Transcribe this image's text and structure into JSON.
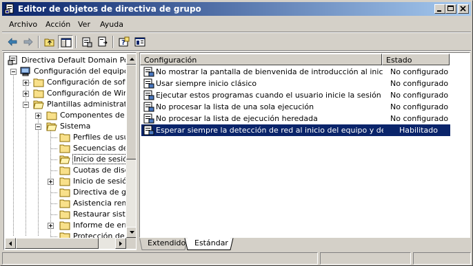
{
  "window": {
    "title": "Editor de objetos de directiva de grupo"
  },
  "menu": [
    "Archivo",
    "Acción",
    "Ver",
    "Ayuda"
  ],
  "toolbar": {
    "buttons": [
      "back-arrow-icon",
      "forward-arrow-icon",
      "up-folder-icon",
      "show-tree-icon",
      "properties-icon",
      "export-list-icon",
      "help-icon",
      "console-icon"
    ]
  },
  "tree": {
    "items": [
      {
        "label": "Directiva Default Domain Policy",
        "icon": "policy-icon"
      },
      {
        "label": "Configuración del equipo",
        "icon": "computer-icon"
      },
      {
        "label": "Configuración de software",
        "icon": "folder-icon"
      },
      {
        "label": "Configuración de Windows",
        "icon": "folder-icon"
      },
      {
        "label": "Plantillas administrativas",
        "icon": "folder-open-icon"
      },
      {
        "label": "Componentes de Windows",
        "icon": "folder-icon"
      },
      {
        "label": "Sistema",
        "icon": "folder-open-icon"
      },
      {
        "label": "Perfiles de usuario",
        "icon": "folder-icon"
      },
      {
        "label": "Secuencias de comandos",
        "icon": "folder-icon"
      },
      {
        "label": "Inicio de sesión",
        "icon": "folder-open-icon"
      },
      {
        "label": "Cuotas de disco",
        "icon": "folder-icon"
      },
      {
        "label": "Inicio de sesión de red",
        "icon": "folder-icon"
      },
      {
        "label": "Directiva de grupo",
        "icon": "folder-icon"
      },
      {
        "label": "Asistencia remota",
        "icon": "folder-icon"
      },
      {
        "label": "Restaurar sistema",
        "icon": "folder-icon"
      },
      {
        "label": "Informe de errores",
        "icon": "folder-icon"
      },
      {
        "label": "Protección de archivos",
        "icon": "folder-icon"
      }
    ]
  },
  "list": {
    "columns": [
      "Configuración",
      "Estado"
    ],
    "rows": [
      {
        "name": "No mostrar la pantalla de bienvenida de introducción al iniciar la s...",
        "state": "No configurado"
      },
      {
        "name": "Usar siempre inicio clásico",
        "state": "No configurado"
      },
      {
        "name": "Ejecutar estos programas cuando el usuario inicie la sesión",
        "state": "No configurado"
      },
      {
        "name": "No procesar la lista de una sola ejecución",
        "state": "No configurado"
      },
      {
        "name": "No procesar la lista de ejecución heredada",
        "state": "No configurado"
      },
      {
        "name": "Esperar siempre la detección de red al inicio del equipo y de sesión",
        "state": "Habilitado"
      }
    ]
  },
  "tabs": [
    "Extendido",
    "Estándar"
  ],
  "colors": {
    "title_start": "#0a246a",
    "title_end": "#a6caf0",
    "selection": "#0a246a",
    "face": "#d4d0c8"
  }
}
